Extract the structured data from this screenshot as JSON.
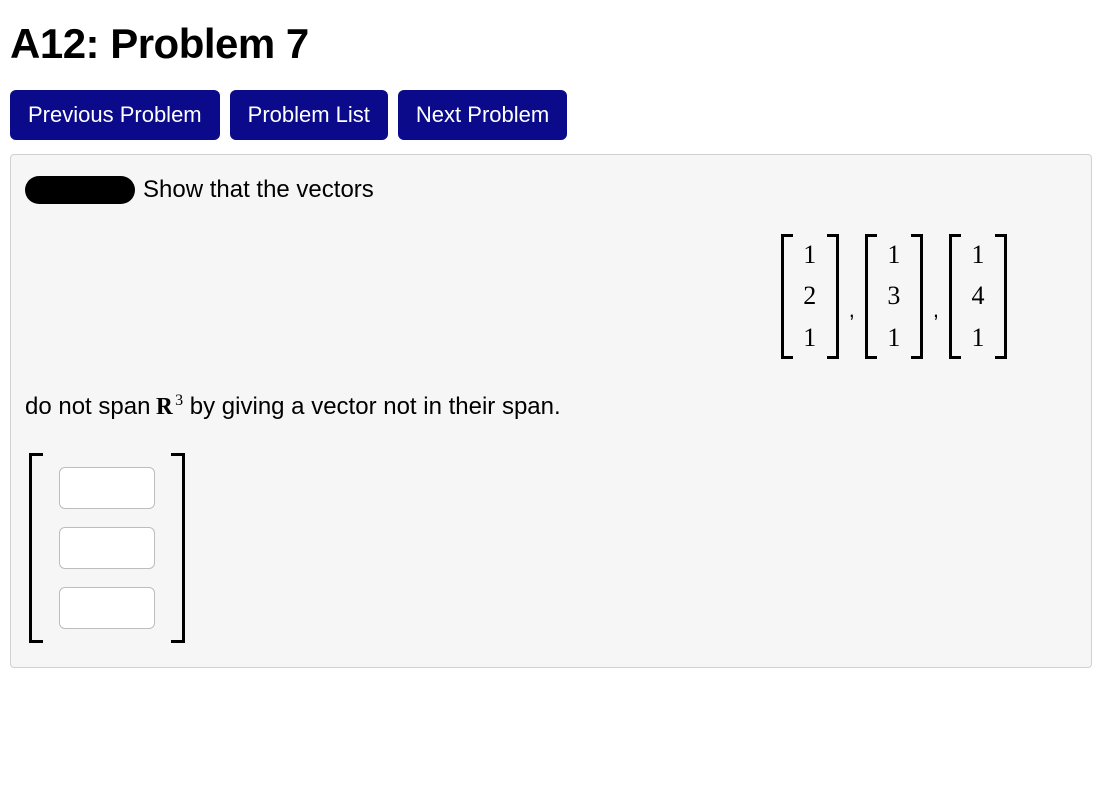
{
  "title": "A12: Problem 7",
  "nav": {
    "prev": "Previous Problem",
    "list": "Problem List",
    "next": "Next Problem"
  },
  "problem": {
    "intro": "Show that the vectors",
    "vectors": [
      {
        "entries": [
          "1",
          "2",
          "1"
        ]
      },
      {
        "entries": [
          "1",
          "3",
          "1"
        ]
      },
      {
        "entries": [
          "1",
          "4",
          "1"
        ]
      }
    ],
    "separator": ",",
    "line2_pre": "do not span ",
    "space_symbol": "R",
    "space_exp": "3",
    "line2_post": " by giving a vector not in their span."
  },
  "answer": {
    "values": [
      "",
      "",
      ""
    ]
  }
}
